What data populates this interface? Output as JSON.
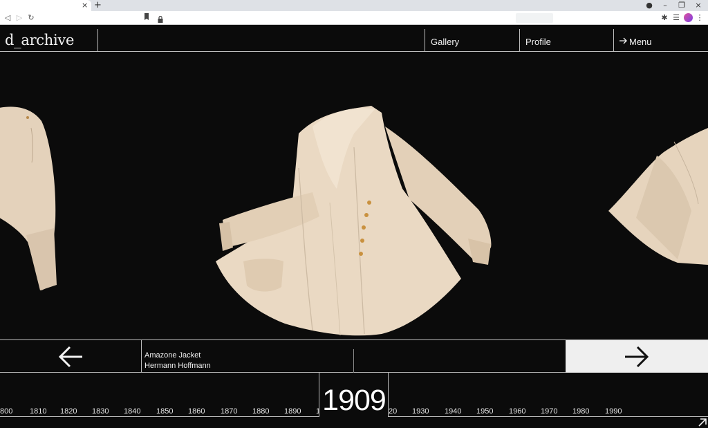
{
  "browser": {
    "tab_close": "×",
    "new_tab": "+",
    "window_controls": [
      "–",
      "❐",
      "×"
    ],
    "toolbar_icons": [
      "back-icon",
      "forward-icon",
      "reload-icon",
      "bookmark-icon",
      "lock-icon",
      "extensions-icon",
      "reading-list-icon",
      "menu-kebab-icon"
    ]
  },
  "site": {
    "logo": "d_archive",
    "nav": {
      "gallery": "Gallery",
      "profile": "Profile",
      "menu": "Menu"
    }
  },
  "item": {
    "title": "Amazone Jacket",
    "designer": "Hermann Hoffmann"
  },
  "timeline": {
    "current_year": "1909",
    "decades": [
      "800",
      "1810",
      "1820",
      "1830",
      "1840",
      "1850",
      "1860",
      "1870",
      "1880",
      "1890",
      "1",
      "20",
      "1930",
      "1940",
      "1950",
      "1960",
      "1970",
      "1980",
      "1990"
    ]
  },
  "colors": {
    "background": "#0b0b0b",
    "text": "#f2f2f2",
    "garment": "#e8d6c0",
    "next_button": "#efefef",
    "rule": "#bdbdbd"
  }
}
